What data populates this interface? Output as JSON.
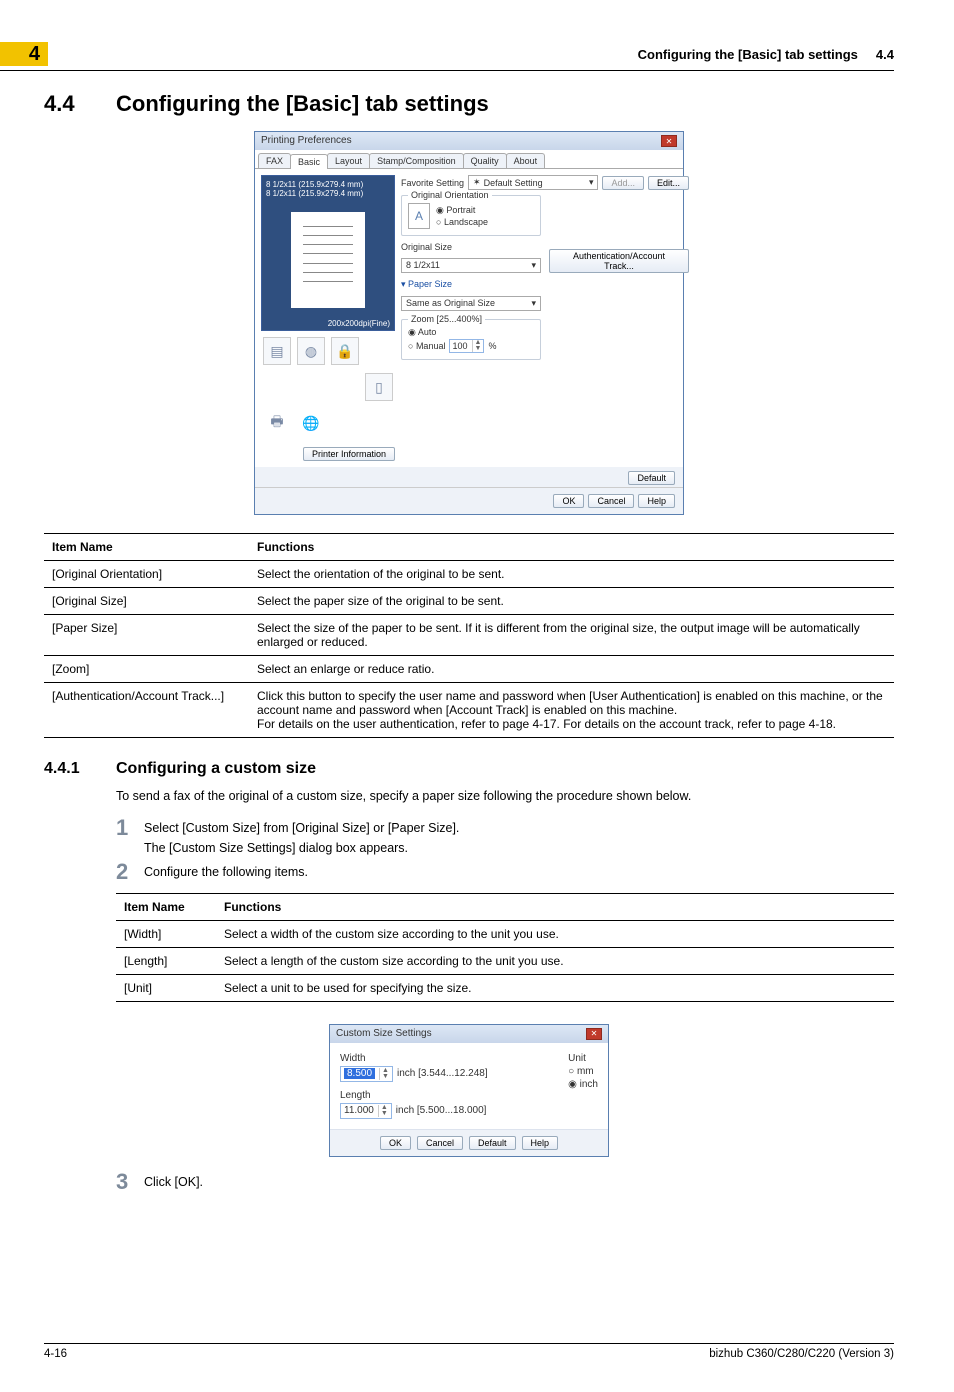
{
  "header": {
    "chapter": "4",
    "title": "Configuring the [Basic] tab settings",
    "section_num": "4.4"
  },
  "section": {
    "num": "4.4",
    "title": "Configuring the [Basic] tab settings"
  },
  "dlg": {
    "title": "Printing Preferences",
    "tabs": [
      "FAX",
      "Basic",
      "Layout",
      "Stamp/Composition",
      "Quality",
      "About"
    ],
    "preview_size_top": "8 1/2x11 (215.9x279.4 mm)",
    "preview_size_bot": "8 1/2x11 (215.9x279.4 mm)",
    "preview_dpi": "200x200dpi(Fine)",
    "printer_info": "Printer Information",
    "favorite_label": "Favorite Setting",
    "favorite_value": "Default Setting",
    "add": "Add...",
    "edit": "Edit...",
    "orientation_title": "Original Orientation",
    "portrait": "Portrait",
    "landscape": "Landscape",
    "original_size_label": "Original Size",
    "original_size_value": "8 1/2x11",
    "paper_size_label": "Paper Size",
    "paper_size_value": "Same as Original Size",
    "zoom_label": "Zoom [25...400%]",
    "auto": "Auto",
    "manual": "Manual",
    "zoom_val": "100",
    "pct": "%",
    "auth_btn": "Authentication/Account Track...",
    "default_btn": "Default",
    "ok": "OK",
    "cancel": "Cancel",
    "help": "Help"
  },
  "table1": {
    "head": [
      "Item Name",
      "Functions"
    ],
    "rows": [
      [
        "[Original Orientation]",
        "Select the orientation of the original to be sent."
      ],
      [
        "[Original Size]",
        "Select the paper size of the original to be sent."
      ],
      [
        "[Paper Size]",
        "Select the size of the paper to be sent. If it is different from the original size, the output image will be automatically enlarged or reduced."
      ],
      [
        "[Zoom]",
        "Select an enlarge or reduce ratio."
      ],
      [
        "[Authentication/Account Track...]",
        "Click this button to specify the user name and password when [User Authentication] is enabled on this machine, or the account name and password when [Account Track] is enabled on this machine.\nFor details on the user authentication, refer to page 4-17. For details on the account track, refer to page 4-18."
      ]
    ]
  },
  "subsection": {
    "num": "4.4.1",
    "title": "Configuring a custom size"
  },
  "intro": "To send a fax of the original of a custom size, specify a paper size following the procedure shown below.",
  "steps": {
    "s1_num": "1",
    "s1_line1": "Select [Custom Size] from [Original Size] or [Paper Size].",
    "s1_line2": "The [Custom Size Settings] dialog box appears.",
    "s2_num": "2",
    "s2_line1": "Configure the following items.",
    "s3_num": "3",
    "s3_line1": "Click [OK]."
  },
  "table2": {
    "head": [
      "Item Name",
      "Functions"
    ],
    "rows": [
      [
        "[Width]",
        "Select a width of the custom size according to the unit you use."
      ],
      [
        "[Length]",
        "Select a length of the custom size according to the unit you use."
      ],
      [
        "[Unit]",
        "Select a unit to be used for specifying the size."
      ]
    ]
  },
  "custom_dlg": {
    "title": "Custom Size Settings",
    "width_label": "Width",
    "width_val": "8.500",
    "width_range": "inch [3.544...12.248]",
    "length_label": "Length",
    "length_val": "11.000",
    "length_range": "inch [5.500...18.000]",
    "unit_label": "Unit",
    "unit_mm": "mm",
    "unit_inch": "inch",
    "ok": "OK",
    "cancel": "Cancel",
    "default": "Default",
    "help": "Help"
  },
  "footer": {
    "page": "4-16",
    "doc": "bizhub C360/C280/C220 (Version 3)"
  }
}
